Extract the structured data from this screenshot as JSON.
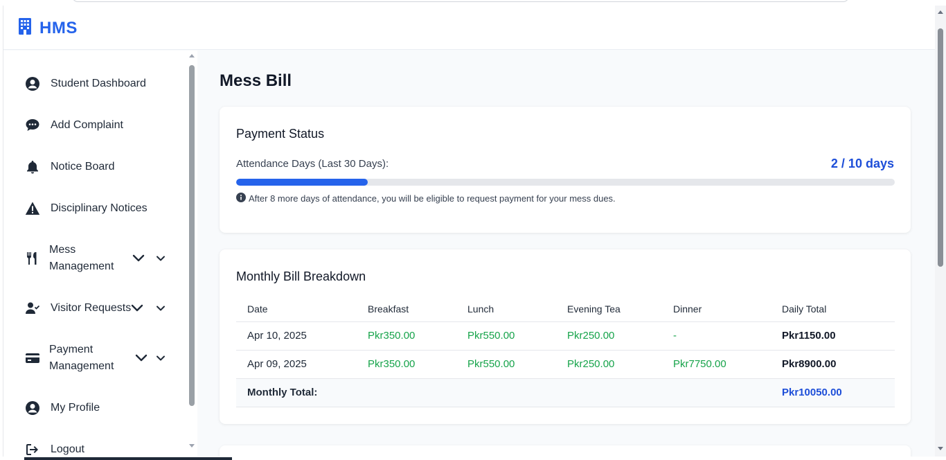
{
  "app": {
    "title": "HMS",
    "brand_color": "#2563eb"
  },
  "sidebar": {
    "items": [
      {
        "label": "Student Dashboard",
        "icon": "user-circle-icon"
      },
      {
        "label": "Add Complaint",
        "icon": "chat-bubble-icon"
      },
      {
        "label": "Notice Board",
        "icon": "bell-icon"
      },
      {
        "label": "Disciplinary Notices",
        "icon": "warning-triangle-icon"
      },
      {
        "label": "Mess Management",
        "icon": "utensils-icon",
        "has_submenu": true
      },
      {
        "label": "Visitor Requests",
        "icon": "user-check-icon",
        "has_submenu": true
      },
      {
        "label": "Payment Management",
        "icon": "credit-card-icon",
        "has_submenu": true
      },
      {
        "label": "My Profile",
        "icon": "user-circle-icon"
      },
      {
        "label": "Logout",
        "icon": "logout-icon"
      }
    ]
  },
  "main": {
    "page_title": "Mess Bill",
    "payment_status": {
      "title": "Payment Status",
      "attendance_label": "Attendance Days (Last 30 Days):",
      "attendance_value": "2 / 10 days",
      "progress_fraction": 0.2,
      "note": "After 8 more days of attendance, you will be eligible to request payment for your mess dues."
    },
    "bill": {
      "title": "Monthly Bill Breakdown",
      "columns": [
        "Date",
        "Breakfast",
        "Lunch",
        "Evening Tea",
        "Dinner",
        "Daily Total"
      ],
      "rows": [
        [
          "Apr 10, 2025",
          "Pkr350.00",
          "Pkr550.00",
          "Pkr250.00",
          "-",
          "Pkr1150.00"
        ],
        [
          "Apr 09, 2025",
          "Pkr350.00",
          "Pkr550.00",
          "Pkr250.00",
          "Pkr7750.00",
          "Pkr8900.00"
        ]
      ],
      "total_label": "Monthly Total:",
      "total_value": "Pkr10050.00"
    }
  }
}
